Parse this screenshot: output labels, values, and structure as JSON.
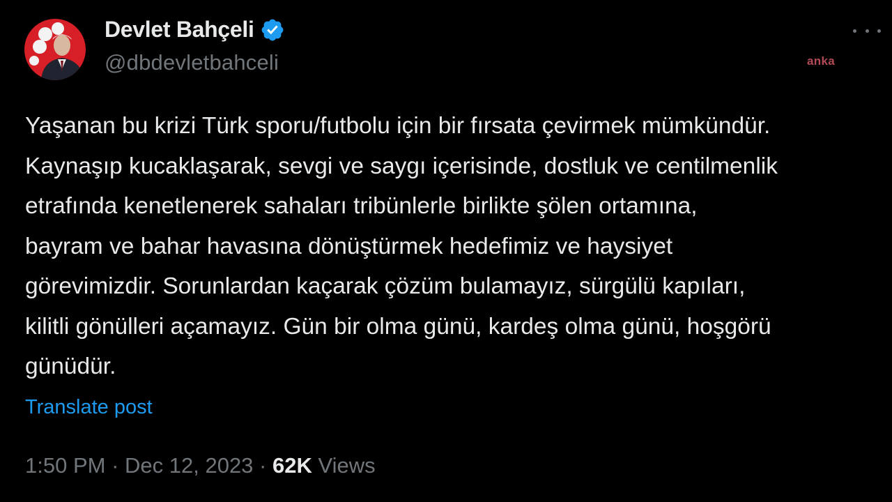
{
  "author": {
    "display_name": "Devlet Bahçeli",
    "handle": "@dbdevletbahceli",
    "verified_icon": "verified-badge-icon"
  },
  "watermark": "anka",
  "tweet": {
    "lines": [
      "Yaşanan bu krizi Türk sporu/futbolu için bir fırsata çevirmek mümkündür.",
      "Kaynaşıp kucaklaşarak, sevgi ve saygı içerisinde, dostluk ve centilmenlik",
      "etrafında kenetlenerek sahaları tribünlerle birlikte şölen ortamına,",
      "bayram ve bahar havasına dönüştürmek hedefimiz ve haysiyet",
      "görevimizdir. Sorunlardan kaçarak çözüm bulamayız, sürgülü kapıları,",
      "kilitli gönülleri açamayız. Gün bir olma günü, kardeş olma günü, hoşgörü",
      "günüdür."
    ]
  },
  "translate_label": "Translate post",
  "meta": {
    "time": "1:50 PM",
    "separator": " · ",
    "date": "Dec 12, 2023",
    "views_count": "62K",
    "views_label": " Views"
  },
  "colors": {
    "background": "#000000",
    "text_primary": "#e7e9ea",
    "text_secondary": "#71767b",
    "link": "#1d9bf0",
    "verified": "#1d9bf0"
  }
}
